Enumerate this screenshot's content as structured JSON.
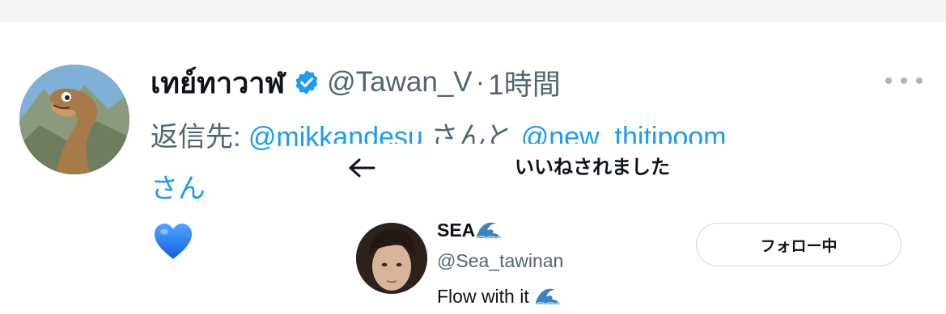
{
  "tweet": {
    "display_name": "เทย์ทาวาฬ",
    "handle": "@Tawan_V",
    "separator": "·",
    "time": "1時間",
    "reply_prefix": "返信先: ",
    "mention_1": "@mikkandesu",
    "joiner": " さんと ",
    "mention_2": "@new_thitipoom",
    "suffix": "さん",
    "verified": true,
    "heart_emoji": "blue-heart-icon"
  },
  "likes_panel": {
    "title": "いいねされました",
    "user": {
      "name": "SEA",
      "handle": "@Sea_tawinan",
      "bio": "Flow with it",
      "follow_label": "フォロー中"
    }
  },
  "colors": {
    "link": "#1d9bf0",
    "secondary_text": "#536471",
    "primary_text": "#0f1419",
    "verified_badge": "#1d9bf0"
  }
}
